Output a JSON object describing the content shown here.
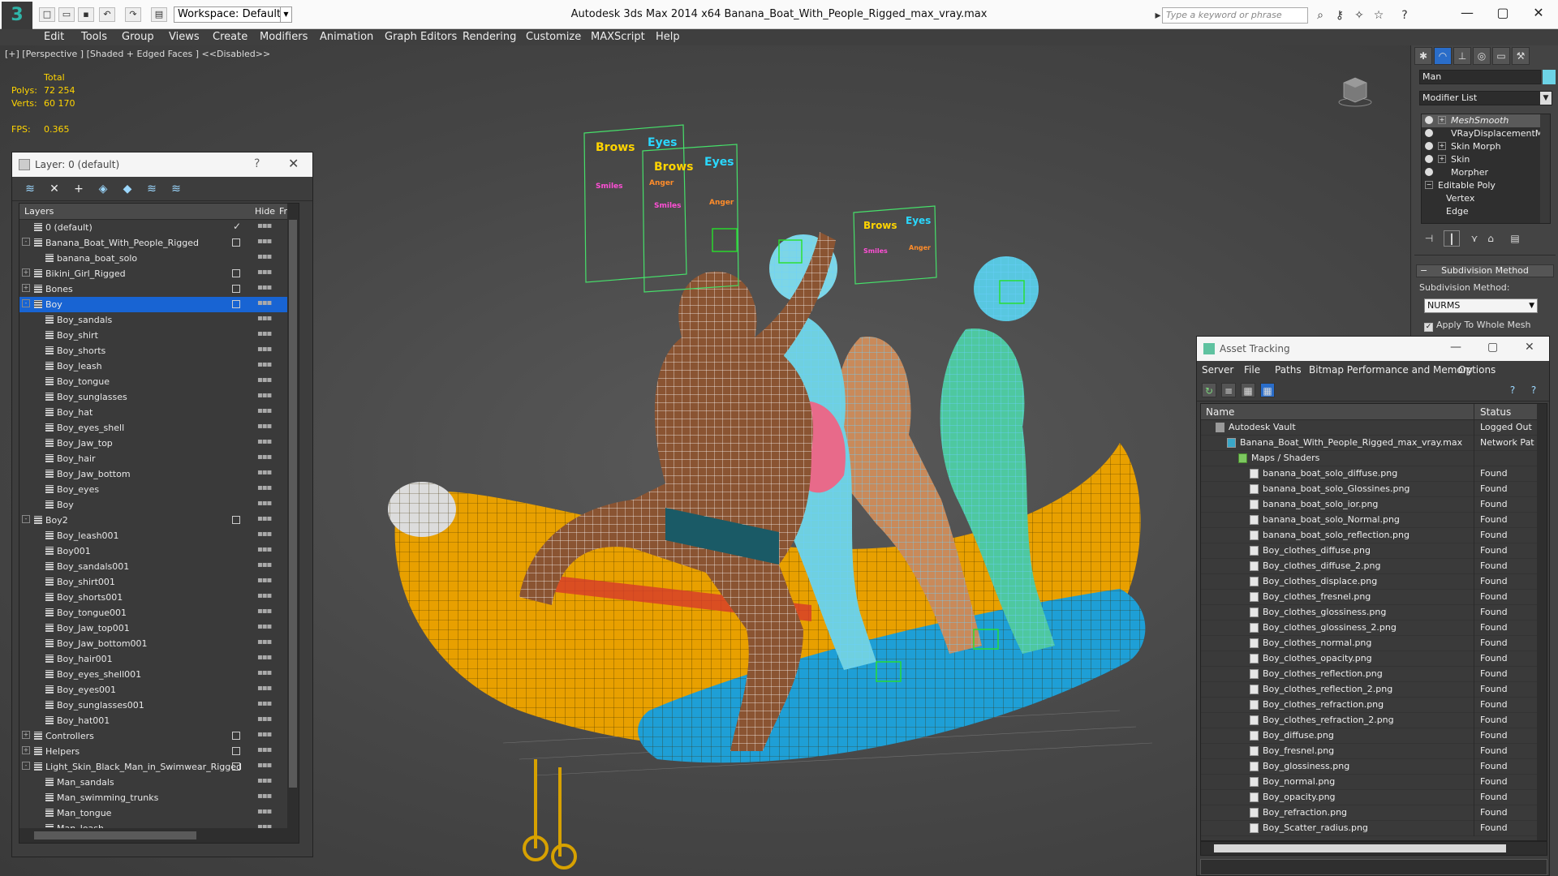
{
  "window": {
    "title": "Autodesk 3ds Max  2014 x64       Banana_Boat_With_People_Rigged_max_vray.max",
    "workspace": "Workspace: Default",
    "search_placeholder": "Type a keyword or phrase"
  },
  "menu": [
    "Edit",
    "Tools",
    "Group",
    "Views",
    "Create",
    "Modifiers",
    "Animation",
    "Graph Editors",
    "Rendering",
    "Customize",
    "MAXScript",
    "Help"
  ],
  "viewport": {
    "label": "[+] [Perspective ] [Shaded + Edged Faces ]  <<Disabled>>",
    "stats": {
      "total_label": "Total",
      "polys_label": "Polys:",
      "polys_value": "72 254",
      "verts_label": "Verts:",
      "verts_value": "60 170",
      "fps_label": "FPS:",
      "fps_value": "0.365"
    },
    "rig_labels": {
      "brows": "Brows",
      "eyes": "Eyes",
      "smiles": "Smiles",
      "anger": "Anger"
    }
  },
  "layer_window": {
    "title": "Layer: 0 (default)",
    "help": "?",
    "columns": {
      "layers": "Layers",
      "hide": "Hide",
      "freeze": "Fr"
    },
    "rows": [
      {
        "label": "0 (default)",
        "level": 0,
        "check": true
      },
      {
        "label": "Banana_Boat_With_People_Rigged",
        "level": 0,
        "expander": "-",
        "box": true
      },
      {
        "label": "banana_boat_solo",
        "level": 1
      },
      {
        "label": "Bikini_Girl_Rigged",
        "level": 0,
        "expander": "+",
        "box": true
      },
      {
        "label": "Bones",
        "level": 0,
        "expander": "+",
        "box": true
      },
      {
        "label": "Boy",
        "level": 0,
        "expander": "-",
        "box": true,
        "selected": true
      },
      {
        "label": "Boy_sandals",
        "level": 1
      },
      {
        "label": "Boy_shirt",
        "level": 1
      },
      {
        "label": "Boy_shorts",
        "level": 1
      },
      {
        "label": "Boy_leash",
        "level": 1
      },
      {
        "label": "Boy_tongue",
        "level": 1
      },
      {
        "label": "Boy_sunglasses",
        "level": 1
      },
      {
        "label": "Boy_hat",
        "level": 1
      },
      {
        "label": "Boy_eyes_shell",
        "level": 1
      },
      {
        "label": "Boy_Jaw_top",
        "level": 1
      },
      {
        "label": "Boy_hair",
        "level": 1
      },
      {
        "label": "Boy_Jaw_bottom",
        "level": 1
      },
      {
        "label": "Boy_eyes",
        "level": 1
      },
      {
        "label": "Boy",
        "level": 1
      },
      {
        "label": "Boy2",
        "level": 0,
        "expander": "-",
        "box": true
      },
      {
        "label": "Boy_leash001",
        "level": 1
      },
      {
        "label": "Boy001",
        "level": 1
      },
      {
        "label": "Boy_sandals001",
        "level": 1
      },
      {
        "label": "Boy_shirt001",
        "level": 1
      },
      {
        "label": "Boy_shorts001",
        "level": 1
      },
      {
        "label": "Boy_tongue001",
        "level": 1
      },
      {
        "label": "Boy_Jaw_top001",
        "level": 1
      },
      {
        "label": "Boy_Jaw_bottom001",
        "level": 1
      },
      {
        "label": "Boy_hair001",
        "level": 1
      },
      {
        "label": "Boy_eyes_shell001",
        "level": 1
      },
      {
        "label": "Boy_eyes001",
        "level": 1
      },
      {
        "label": "Boy_sunglasses001",
        "level": 1
      },
      {
        "label": "Boy_hat001",
        "level": 1
      },
      {
        "label": "Controllers",
        "level": 0,
        "expander": "+",
        "box": true
      },
      {
        "label": "Helpers",
        "level": 0,
        "expander": "+",
        "box": true
      },
      {
        "label": "Light_Skin_Black_Man_in_Swimwear_Rigged",
        "level": 0,
        "expander": "-",
        "box": true
      },
      {
        "label": "Man_sandals",
        "level": 1
      },
      {
        "label": "Man_swimming_trunks",
        "level": 1
      },
      {
        "label": "Man_tongue",
        "level": 1
      },
      {
        "label": "Man_leash",
        "level": 1
      }
    ]
  },
  "command_panel": {
    "object_name": "Man",
    "object_color": "#6dd3e6",
    "modifier_list": "Modifier List",
    "stack": [
      {
        "name": "MeshSmooth",
        "plus": true,
        "bulb": true,
        "italic": true
      },
      {
        "name": "VRayDisplacementMod",
        "plus": false,
        "bulb": true
      },
      {
        "name": "Skin Morph",
        "plus": true,
        "bulb": true
      },
      {
        "name": "Skin",
        "plus": true,
        "bulb": true
      },
      {
        "name": "Morpher",
        "plus": false,
        "bulb": true
      },
      {
        "name": "Editable Poly",
        "plus": false,
        "bulb": false,
        "minus": true
      },
      {
        "name": "Vertex",
        "sub": true
      },
      {
        "name": "Edge",
        "sub": true
      }
    ],
    "rollout_title": "Subdivision Method",
    "sub_label": "Subdivision Method:",
    "method": "NURMS",
    "apply_label": "Apply To Whole Mesh"
  },
  "asset_window": {
    "title": "Asset Tracking",
    "menu": [
      "Server",
      "File",
      "Paths",
      "Bitmap Performance and Memory",
      "Options"
    ],
    "columns": {
      "name": "Name",
      "status": "Status"
    },
    "rows": [
      {
        "name": "Autodesk Vault",
        "status": "Logged Out",
        "level": 0,
        "kind": "vault"
      },
      {
        "name": "Banana_Boat_With_People_Rigged_max_vray.max",
        "status": "Network Pat",
        "level": 1,
        "kind": "max"
      },
      {
        "name": "Maps / Shaders",
        "status": "",
        "level": 2,
        "kind": "folder"
      },
      {
        "name": "banana_boat_solo_diffuse.png",
        "status": "Found",
        "level": 3
      },
      {
        "name": "banana_boat_solo_Glossines.png",
        "status": "Found",
        "level": 3
      },
      {
        "name": "banana_boat_solo_ior.png",
        "status": "Found",
        "level": 3
      },
      {
        "name": "banana_boat_solo_Normal.png",
        "status": "Found",
        "level": 3
      },
      {
        "name": "banana_boat_solo_reflection.png",
        "status": "Found",
        "level": 3
      },
      {
        "name": "Boy_clothes_diffuse.png",
        "status": "Found",
        "level": 3
      },
      {
        "name": "Boy_clothes_diffuse_2.png",
        "status": "Found",
        "level": 3
      },
      {
        "name": "Boy_clothes_displace.png",
        "status": "Found",
        "level": 3
      },
      {
        "name": "Boy_clothes_fresnel.png",
        "status": "Found",
        "level": 3
      },
      {
        "name": "Boy_clothes_glossiness.png",
        "status": "Found",
        "level": 3
      },
      {
        "name": "Boy_clothes_glossiness_2.png",
        "status": "Found",
        "level": 3
      },
      {
        "name": "Boy_clothes_normal.png",
        "status": "Found",
        "level": 3
      },
      {
        "name": "Boy_clothes_opacity.png",
        "status": "Found",
        "level": 3
      },
      {
        "name": "Boy_clothes_reflection.png",
        "status": "Found",
        "level": 3
      },
      {
        "name": "Boy_clothes_reflection_2.png",
        "status": "Found",
        "level": 3
      },
      {
        "name": "Boy_clothes_refraction.png",
        "status": "Found",
        "level": 3
      },
      {
        "name": "Boy_clothes_refraction_2.png",
        "status": "Found",
        "level": 3
      },
      {
        "name": "Boy_diffuse.png",
        "status": "Found",
        "level": 3
      },
      {
        "name": "Boy_fresnel.png",
        "status": "Found",
        "level": 3
      },
      {
        "name": "Boy_glossiness.png",
        "status": "Found",
        "level": 3
      },
      {
        "name": "Boy_normal.png",
        "status": "Found",
        "level": 3
      },
      {
        "name": "Boy_opacity.png",
        "status": "Found",
        "level": 3
      },
      {
        "name": "Boy_refraction.png",
        "status": "Found",
        "level": 3
      },
      {
        "name": "Boy_Scatter_radius.png",
        "status": "Found",
        "level": 3
      }
    ]
  }
}
